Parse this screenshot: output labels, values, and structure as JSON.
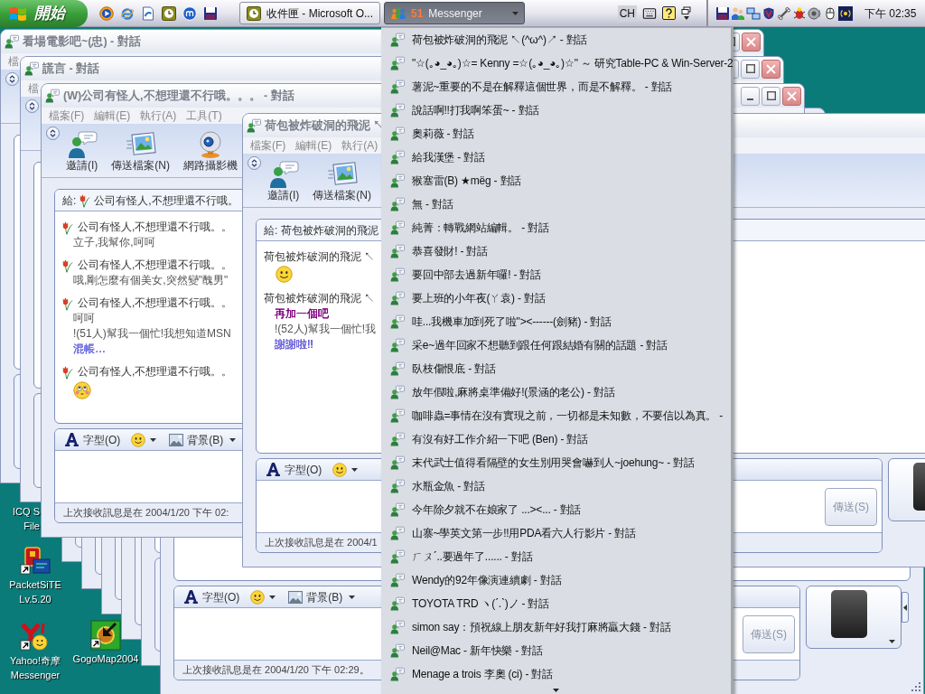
{
  "taskbar": {
    "start_button": "開始",
    "tasks": [
      {
        "label": "收件匣 - Microsoft O...",
        "selected": false
      },
      {
        "badge": "51",
        "label": "Messenger",
        "selected": true
      }
    ],
    "language": "CH",
    "clock": "下午 02:35"
  },
  "desktop_icons": [
    {
      "lines": [
        "ICQ S",
        "File"
      ]
    },
    {
      "lines": [
        "PacketSiTE",
        "Lv.5.20"
      ]
    },
    {
      "lines": [
        "Yahoo!奇摩",
        "Messenger"
      ]
    },
    {
      "lines": [
        "GogoMap2004"
      ]
    }
  ],
  "windows": [
    {
      "title": "看場電影吧~(忠) - 對話",
      "menu": [
        "檔"
      ]
    },
    {
      "title": "謊言 - 對話",
      "menu": [
        "檔"
      ]
    },
    {
      "title": "(W)公司有怪人,不想理還不行哦。。。 - 對話",
      "menu": [
        "檔案(F)",
        "編輯(E)",
        "執行(A)",
        "工具(T)"
      ],
      "toolbar": [
        "邀請(I)",
        "傳送檔案(N)",
        "網路攝影機"
      ],
      "recipient": {
        "label": "給:",
        "flower": true,
        "name": "公司有怪人,不想理還不行哦。"
      },
      "messages": [
        {
          "kind": "sender",
          "flower": true,
          "text": "公司有怪人,不想理還不行哦。。"
        },
        {
          "kind": "text",
          "text": "立子,我幫你,呵呵"
        },
        {
          "kind": "sender",
          "flower": true,
          "text": "公司有怪人,不想理還不行哦。。"
        },
        {
          "kind": "text",
          "text": "哦,剛怎麼有個美女,突然變\"醜男\""
        },
        {
          "kind": "sender",
          "flower": true,
          "text": "公司有怪人,不想理還不行哦。。"
        },
        {
          "kind": "text",
          "text": "呵呵"
        },
        {
          "kind": "text",
          "text": "!(51人)幫我一個忙!我想知道MSN"
        },
        {
          "kind": "text",
          "text": "混帳…",
          "color": "#6f6fe0"
        },
        {
          "kind": "sender",
          "flower": true,
          "text": "公司有怪人,不想理還不行哦。。"
        },
        {
          "kind": "blush"
        }
      ],
      "compose": {
        "font": "字型(O)",
        "background": "背景(B)"
      },
      "status": "上次接收訊息是在 2004/1/20 下午 02:"
    },
    {
      "title": "荷包被炸破洞的飛泥 ↖",
      "menu": [
        "檔案(F)",
        "編輯(E)",
        "執行(A)"
      ],
      "toolbar": [
        "邀請(I)",
        "傳送檔案(N)"
      ],
      "recipient": {
        "label": "給:",
        "name": "荷包被炸破洞的飛泥"
      },
      "messages": [
        {
          "kind": "sender",
          "text": "荷包被炸破洞的飛泥 ↖"
        },
        {
          "kind": "smiley"
        },
        {
          "kind": "sender",
          "text": "荷包被炸破洞的飛泥 ↖"
        },
        {
          "kind": "text",
          "text": "再加一個吧",
          "color": "#800080"
        },
        {
          "kind": "text",
          "text": "!(52人)幫我一個忙!我"
        },
        {
          "kind": "text",
          "text": "謝謝啦!!",
          "color": "#6b63d8"
        }
      ],
      "compose": {
        "font": "字型(O)"
      },
      "status": "上次接收訊息是在 2004/1",
      "send_button": {
        "label": "傳送(S)",
        "disabled": true
      },
      "avatar": true
    },
    {
      "compose": {
        "font": "字型(O)",
        "background": "背景(B)"
      },
      "status": "上次接收訊息是在 2004/1/20 下午 02:29。",
      "send_button": {
        "label": "傳送(S)",
        "disabled": true
      },
      "avatar": true
    }
  ],
  "conversation_menu": [
    "荷包被炸破洞的飛泥 ↖(^ω^)↗ - 對話",
    "\"☆(｡◕_◕｡)☆= Kenny =☆(｡◕_◕｡)☆\" ～ 研究Table-PC & Win-Server-2",
    "薯泥~重要的不是在解釋這個世界，而是不解釋。 - 對話",
    "說話啊!!打我啊笨蛋~ - 對話",
    "奧莉薇 - 對話",
    "給我漢堡 - 對話",
    "猴塞雷(B) ★mëg - 對話",
    "無 - 對話",
    "純菁：轉戰網站編輯。 - 對話",
    "恭喜發財! - 對話",
    "要回中部去過新年囉! - 對話",
    "要上班的小年夜(ㄚ袁) - 對話",
    "哇...我機車加到死了啦\"><------(劍豬) - 對話",
    "采e~過年回家不想聽到跟任何跟結婚有關的話題 - 對話",
    "臥枝傷恨底 - 對話",
    "放年假啦,麻將桌準備好!(景涵的老公) - 對話",
    "咖啡蟲=事情在沒有實現之前，一切都是未知數，不要信以為真。 -",
    "有沒有好工作介紹一下吧 (Ben) - 對話",
    "末代武士值得看隔壁的女生別用哭會嚇到人~joehung~ - 對話",
    "水瓶金魚 - 對話",
    "今年除夕就不在娘家了 ...><... - 對話",
    "山寨~學英文第一步!!用PDA看六人行影片 - 對話",
    "ㄏㄡˊ..要過年了...... - 對話",
    "Wendy的92年像演連續劇 - 對話",
    "TOYOTA TRD ヽ(ˊ.ˋ)ノ - 對話",
    "simon say：預祝線上朋友新年好我打麻將贏大錢 - 對話",
    "Neil@Mac - 新年快樂 - 對話",
    "Menage a trois 李奧 (ci) - 對話"
  ]
}
